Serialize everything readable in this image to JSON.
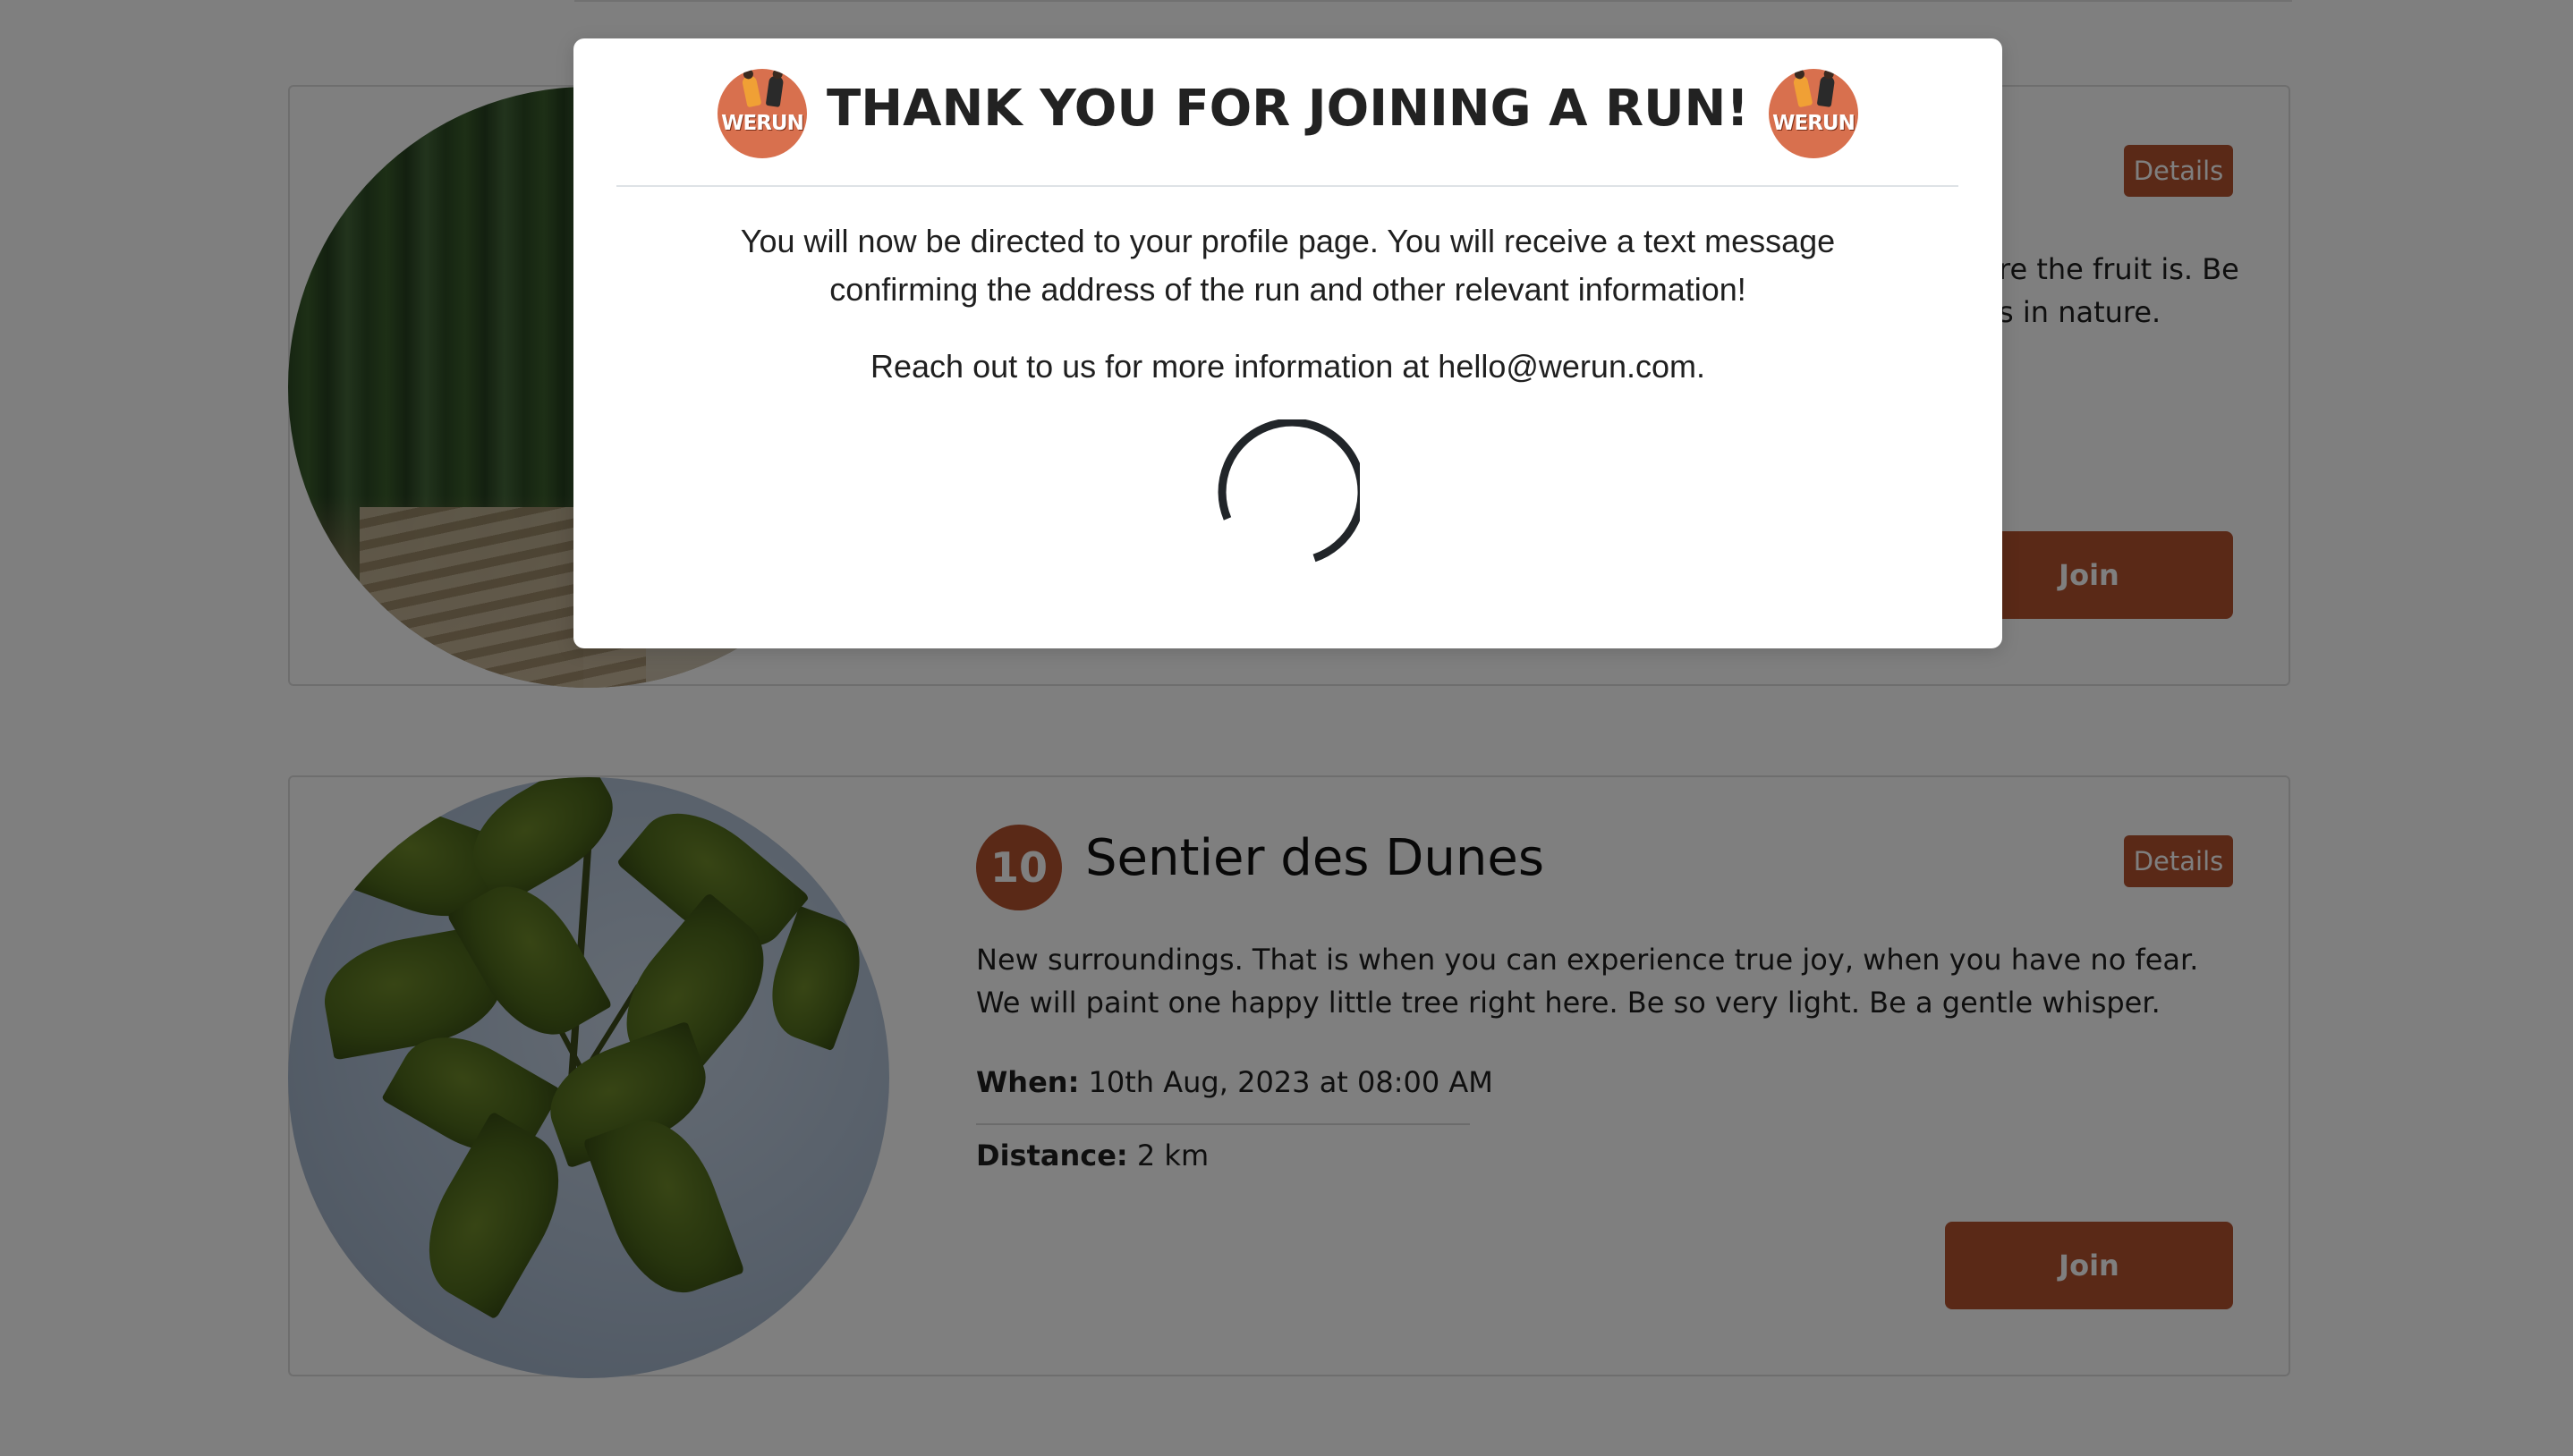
{
  "cards": [
    {
      "number": "",
      "title": "",
      "details_label": "Details",
      "description_visible": "re the fruit is. Be\ns in nature.",
      "join_label": "Join"
    },
    {
      "number": "10",
      "title": "Sentier des Dunes",
      "details_label": "Details",
      "description": "New surroundings. That is when you can experience true joy, when you have no fear. We will paint one happy little tree right here. Be so very light. Be a gentle whisper.",
      "when_label": "When:",
      "when_value": "10th Aug, 2023 at 08:00 AM",
      "distance_label": "Distance:",
      "distance_value": "2 km",
      "join_label": "Join"
    }
  ],
  "modal": {
    "logo_text": "WERUN",
    "title": "THANK YOU FOR JOINING A RUN!",
    "message": "You will now be directed to your profile page. You will receive a text message confirming the address of the run and other relevant information!",
    "contact": "Reach out to us for more information at hello@werun.com.",
    "loading_icon": "spinner-icon"
  },
  "colors": {
    "accent": "#b5532f",
    "logo_bg": "#d8704e",
    "backdrop": "rgba(0,0,0,0.5)"
  }
}
